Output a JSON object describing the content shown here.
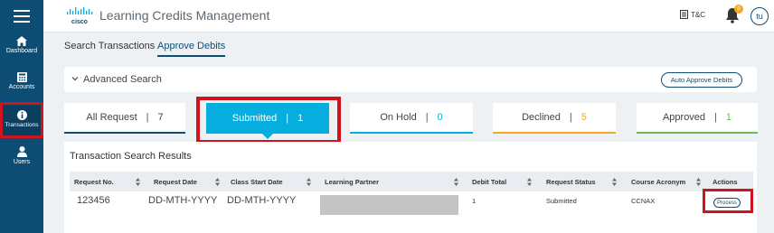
{
  "sidebar": {
    "items": [
      {
        "label": "Dashboard",
        "icon": "home-icon"
      },
      {
        "label": "Accounts",
        "icon": "calculator-icon"
      },
      {
        "label": "Transactions",
        "icon": "info-icon"
      },
      {
        "label": "Users",
        "icon": "user-icon"
      }
    ]
  },
  "header": {
    "logo": "cisco",
    "title": "Learning Credits Management",
    "tc_label": "T&C",
    "notification_count": "0",
    "avatar_initials": "tu"
  },
  "tabs": [
    {
      "label": "Search Transactions",
      "active": false
    },
    {
      "label": "Approve Debits",
      "active": true
    }
  ],
  "advanced_search": {
    "label": "Advanced Search",
    "auto_approve_label": "Auto Approve Debits"
  },
  "status_cards": [
    {
      "label": "All Request",
      "count": "7",
      "color": "#0d4d74"
    },
    {
      "label": "Submitted",
      "count": "1",
      "color": "#06aedf",
      "active": true
    },
    {
      "label": "On Hold",
      "count": "0",
      "color": "#06aedf"
    },
    {
      "label": "Declined",
      "count": "5",
      "color": "#f5a623"
    },
    {
      "label": "Approved",
      "count": "1",
      "color": "#6cc04a"
    }
  ],
  "results": {
    "title": "Transaction Search Results",
    "columns": [
      "Request No.",
      "Request Date",
      "Class Start Date",
      "Learning Partner",
      "Debit Total",
      "Request Status",
      "Course Acronym",
      "Actions"
    ],
    "rows": [
      {
        "request_no": "123456",
        "request_date": "DD-MTH-YYYY",
        "class_start_date": "DD-MTH-YYYY",
        "learning_partner": "",
        "debit_total": "1",
        "request_status": "Submitted",
        "course_acronym": "CCNAX",
        "action_label": "Process"
      }
    ]
  },
  "colors": {
    "sidebar": "#0d4d74",
    "highlight": "#d0141e",
    "accent": "#06aedf"
  }
}
